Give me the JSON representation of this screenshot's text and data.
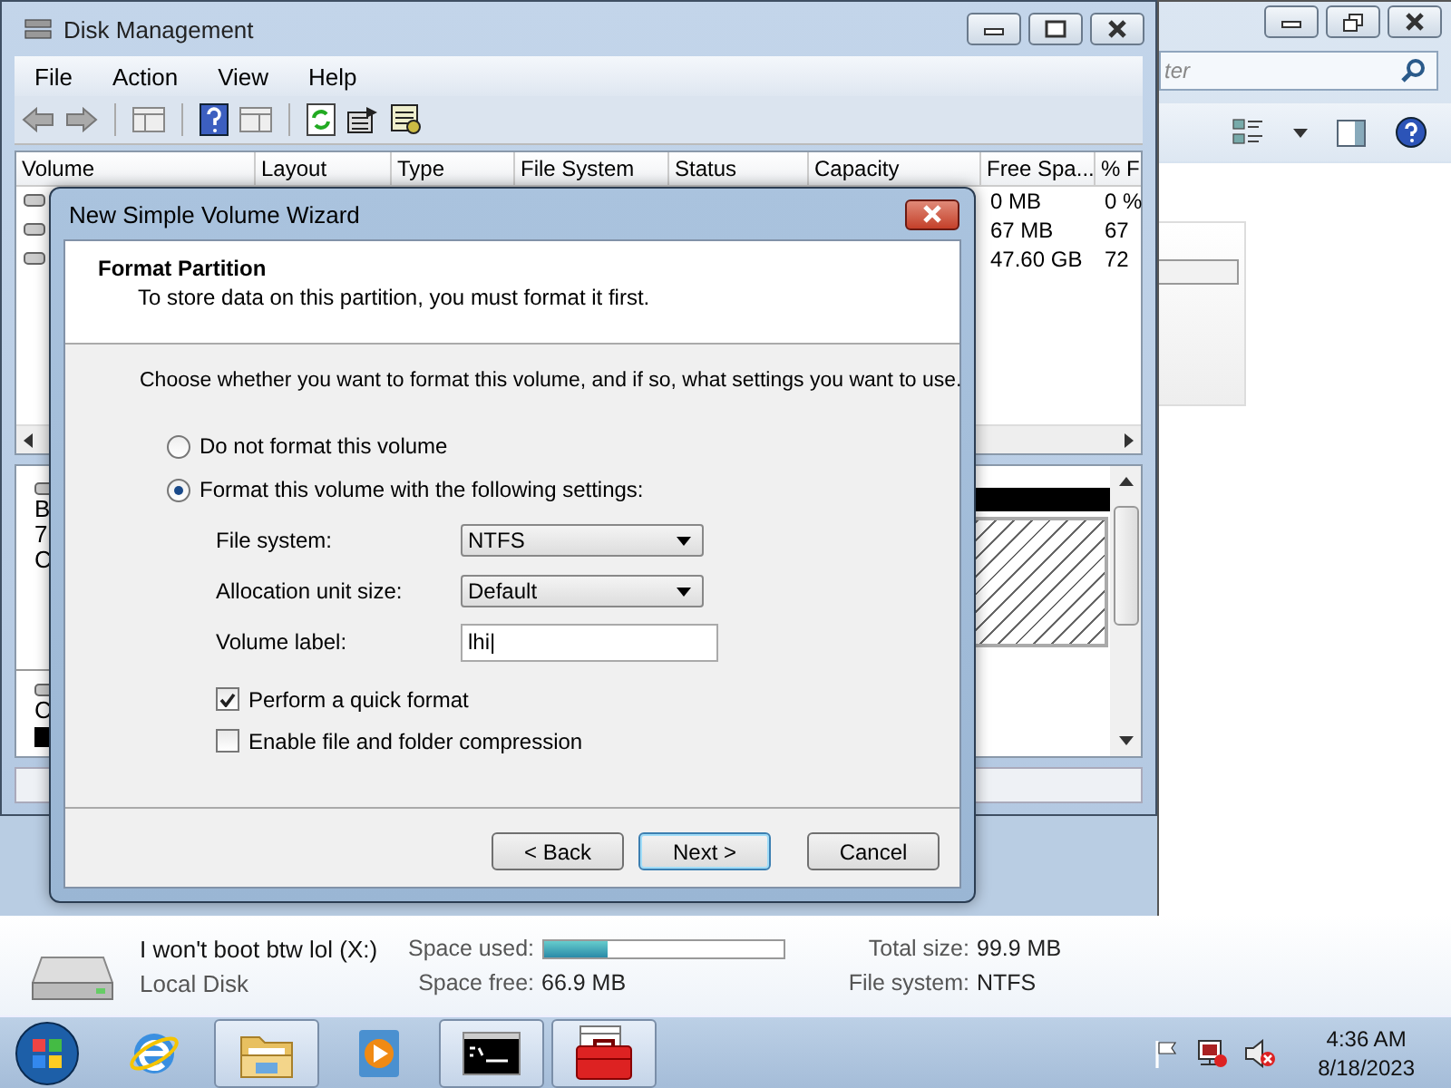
{
  "explorer": {
    "search_placeholder": "ter"
  },
  "disk_management": {
    "title": "Disk Management",
    "menu": [
      "File",
      "Action",
      "View",
      "Help"
    ],
    "columns": [
      "Volume",
      "Layout",
      "Type",
      "File System",
      "Status",
      "Capacity",
      "Free Spa...",
      "% F"
    ],
    "rows": [
      {
        "free": "0 MB",
        "percent": "0 %"
      },
      {
        "free": "67 MB",
        "percent": "67"
      },
      {
        "free": "47.60 GB",
        "percent": "72"
      }
    ],
    "disks": [
      {
        "lines": [
          "B",
          "7",
          "C"
        ]
      },
      {
        "lines": [
          "C"
        ]
      }
    ]
  },
  "wizard": {
    "title": "New Simple Volume Wizard",
    "heading": "Format Partition",
    "subheading": "To store data on this partition, you must format it first.",
    "instruction": "Choose whether you want to format this volume, and if so, what settings you want to use.",
    "options": [
      {
        "label": "Do not format this volume",
        "selected": false
      },
      {
        "label": "Format this volume with the following settings:",
        "selected": true
      }
    ],
    "fields": [
      {
        "label": "File system:",
        "kind": "dropdown",
        "value": "NTFS"
      },
      {
        "label": "Allocation unit size:",
        "kind": "dropdown",
        "value": "Default"
      },
      {
        "label": "Volume label:",
        "kind": "text",
        "value": "lhi|"
      }
    ],
    "checkboxes": [
      {
        "label": "Perform a quick format",
        "checked": true
      },
      {
        "label": "Enable file and folder compression",
        "checked": false
      }
    ],
    "buttons": [
      {
        "label": "< Back",
        "default": false
      },
      {
        "label": "Next >",
        "default": true
      },
      {
        "label": "Cancel",
        "default": false
      }
    ]
  },
  "details": {
    "name": "I won't boot btw lol (X:)",
    "type": "Local Disk",
    "space_used_label": "Space used:",
    "level": 0.27,
    "space_free_label": "Space free:",
    "space_free": "66.9 MB",
    "total_size_label": "Total size:",
    "total_size": "99.9 MB",
    "file_system_label": "File system:",
    "file_system": "NTFS"
  },
  "taskbar": {
    "items": [
      {
        "kind": "browser",
        "active": false
      },
      {
        "kind": "folder",
        "active": true
      },
      {
        "kind": "media",
        "active": false
      },
      {
        "kind": "console",
        "active": true
      },
      {
        "kind": "toolbox",
        "active": true
      }
    ],
    "time": "4:36 AM",
    "date": "8/18/2023"
  }
}
